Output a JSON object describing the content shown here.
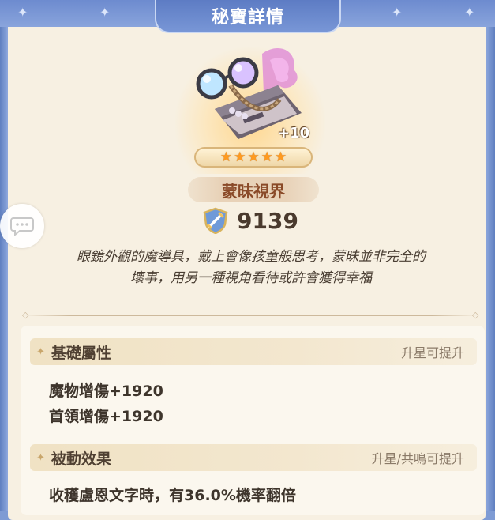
{
  "header": {
    "title": "秘寶詳情"
  },
  "item": {
    "level_bonus": "+10",
    "stars": 5,
    "name": "蒙昧視界",
    "power": "9139",
    "description_lines": [
      "眼鏡外觀的魔導具，戴上會像孩童般思考，蒙昧並非完全的",
      "壞事，用另一種視角看待或許會獲得幸福"
    ]
  },
  "basic_attributes": {
    "title": "基礎屬性",
    "hint": "升星可提升",
    "lines": [
      "魔物增傷+1920",
      "首領增傷+1920"
    ]
  },
  "passive_effect": {
    "title": "被動效果",
    "hint": "升星/共鳴可提升",
    "lines": [
      "收穫盧恩文字時，有36.0%機率翻倍"
    ]
  },
  "colors": {
    "accent_blue": "#6d8bcf",
    "panel_bg": "#f7f0e2",
    "star_orange": "#ff9a1f",
    "name_brown": "#8a4a28"
  },
  "icons": [
    "sparkle-icon",
    "star-icon",
    "sword-shield-icon",
    "chat-bubble-icon",
    "diamond-icon"
  ]
}
